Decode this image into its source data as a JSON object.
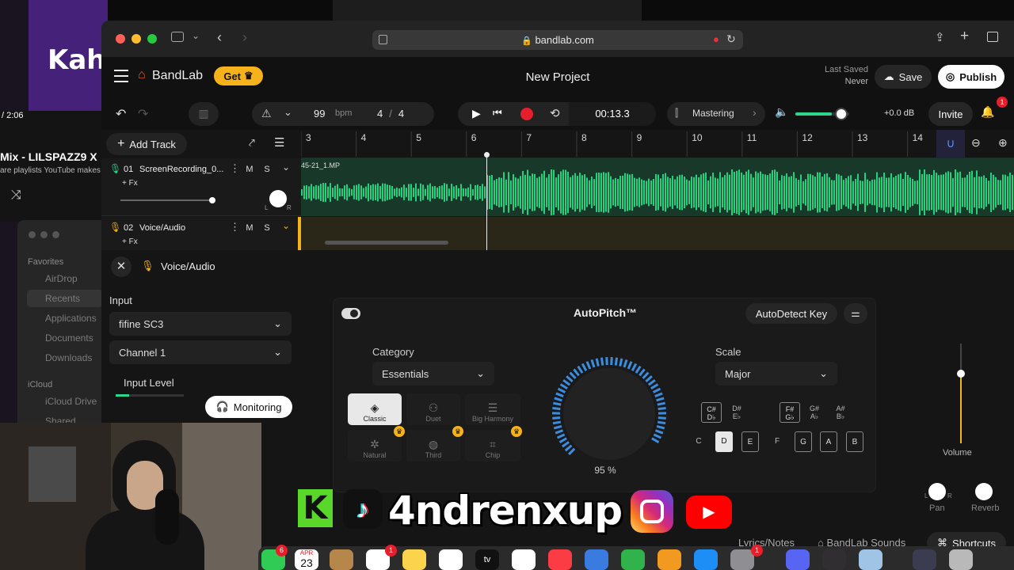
{
  "background": {
    "kahoot_text": "Kah",
    "yt_time": "/ 2:06",
    "yt_title": "Mix - LILSPAZZ9 X",
    "yt_subtitle": "are playlists YouTube makes",
    "finder": {
      "favorites_label": "Favorites",
      "items": [
        "AirDrop",
        "Recents",
        "Applications",
        "Documents",
        "Downloads"
      ],
      "icloud_label": "iCloud",
      "icloud_items": [
        "iCloud Drive",
        "Shared"
      ]
    }
  },
  "browser": {
    "url": "bandlab.com"
  },
  "header": {
    "brand": "BandLab",
    "get_label": "Get",
    "project_title": "New Project",
    "last_saved_label": "Last Saved",
    "last_saved_value": "Never",
    "save_label": "Save",
    "publish_label": "Publish"
  },
  "transport": {
    "bpm_value": "99",
    "bpm_unit": "bpm",
    "time_sig_num": "4",
    "time_sig_sep": "/",
    "time_sig_den": "4",
    "time": "00:13.3",
    "mastering_label": "Mastering",
    "volume_db": "+0.0 dB",
    "invite_label": "Invite",
    "notification_count": "1"
  },
  "tracks_toolbar": {
    "add_track_label": "Add Track"
  },
  "ruler": {
    "ticks": [
      "3",
      "4",
      "5",
      "6",
      "7",
      "8",
      "9",
      "10",
      "11",
      "12",
      "13",
      "14"
    ]
  },
  "tracks": [
    {
      "number": "01",
      "name": "ScreenRecording_0...",
      "fx": "+ Fx",
      "mute": "M",
      "solo": "S",
      "clip_label": "45-21_1.MP",
      "pan_l": "L",
      "pan_r": "R"
    },
    {
      "number": "02",
      "name": "Voice/Audio",
      "fx": "+ Fx",
      "mute": "M",
      "solo": "S"
    }
  ],
  "panel": {
    "track_name": "Voice/Audio",
    "input_label": "Input",
    "input_device": "fifine SC3",
    "input_channel": "Channel 1",
    "input_level_label": "Input Level",
    "monitoring_label": "Monitoring",
    "autopitch": {
      "title": "AutoPitch™",
      "autodetect_label": "AutoDetect Key",
      "category_label": "Category",
      "category_value": "Essentials",
      "scale_label": "Scale",
      "scale_value": "Major",
      "knob_value": "95 %",
      "knob_level": 0.95,
      "categories": [
        "Classic",
        "Duet",
        "Big Harmony",
        "Natural",
        "Third",
        "Chip"
      ],
      "sharps": [
        {
          "top": "C#",
          "bottom": "D♭"
        },
        {
          "top": "D#",
          "bottom": "E♭"
        },
        {
          "top": "F#",
          "bottom": "G♭"
        },
        {
          "top": "G#",
          "bottom": "A♭"
        },
        {
          "top": "A#",
          "bottom": "B♭"
        }
      ],
      "naturals": [
        "C",
        "D",
        "E",
        "F",
        "G",
        "A",
        "B"
      ]
    },
    "volume_label": "Volume",
    "pan_label": "Pan",
    "pan_l": "L",
    "pan_r": "R",
    "reverb_label": "Reverb"
  },
  "bottom_bar": {
    "lyrics_label": "Lyrics/Notes",
    "sounds_label": "BandLab Sounds",
    "shortcuts_label": "Shortcuts"
  },
  "overlay": {
    "handle": "4ndrenxup"
  },
  "dock": {
    "calendar_month": "APR",
    "calendar_day": "23",
    "messages_badge": "6",
    "reminders_badge": "1",
    "settings_badge": "1"
  },
  "colors": {
    "accent_orange": "#f05a28",
    "waveform_green": "#22d27f",
    "get_yellow": "#f6b21b",
    "record_red": "#e5202c"
  }
}
